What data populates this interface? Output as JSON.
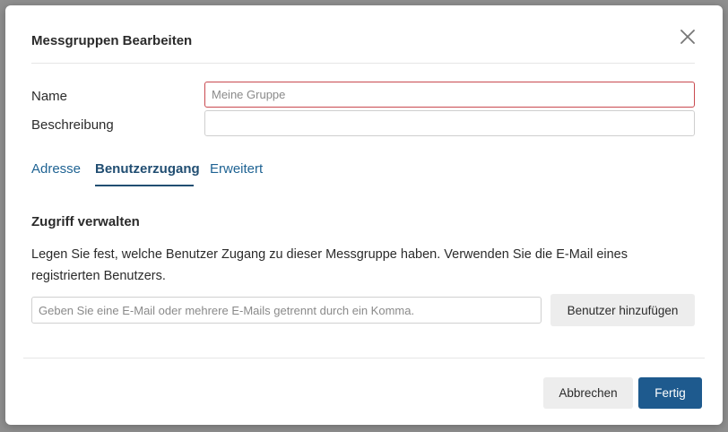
{
  "dialog": {
    "title": "Messgruppen Bearbeiten",
    "name_label": "Name",
    "name_placeholder": "Meine Gruppe",
    "description_label": "Beschreibung",
    "description_value": ""
  },
  "tabs": [
    {
      "label": "Adresse",
      "active": false
    },
    {
      "label": "Benutzerzugang",
      "active": true
    },
    {
      "label": "Erweitert",
      "active": false
    }
  ],
  "access": {
    "title": "Zugriff verwalten",
    "description": "Legen Sie fest, welche Benutzer Zugang zu dieser Messgruppe haben. Verwenden Sie die E-Mail eines registrierten Benutzers.",
    "email_placeholder": "Geben Sie eine E-Mail oder mehrere E-Mails getrennt durch ein Komma.",
    "add_button": "Benutzer hinzufügen"
  },
  "footer": {
    "cancel_label": "Abbrechen",
    "done_label": "Fertig"
  },
  "colors": {
    "primary": "#1e5a8e",
    "tab_link": "#1f6393",
    "error_border": "#c9494f"
  }
}
